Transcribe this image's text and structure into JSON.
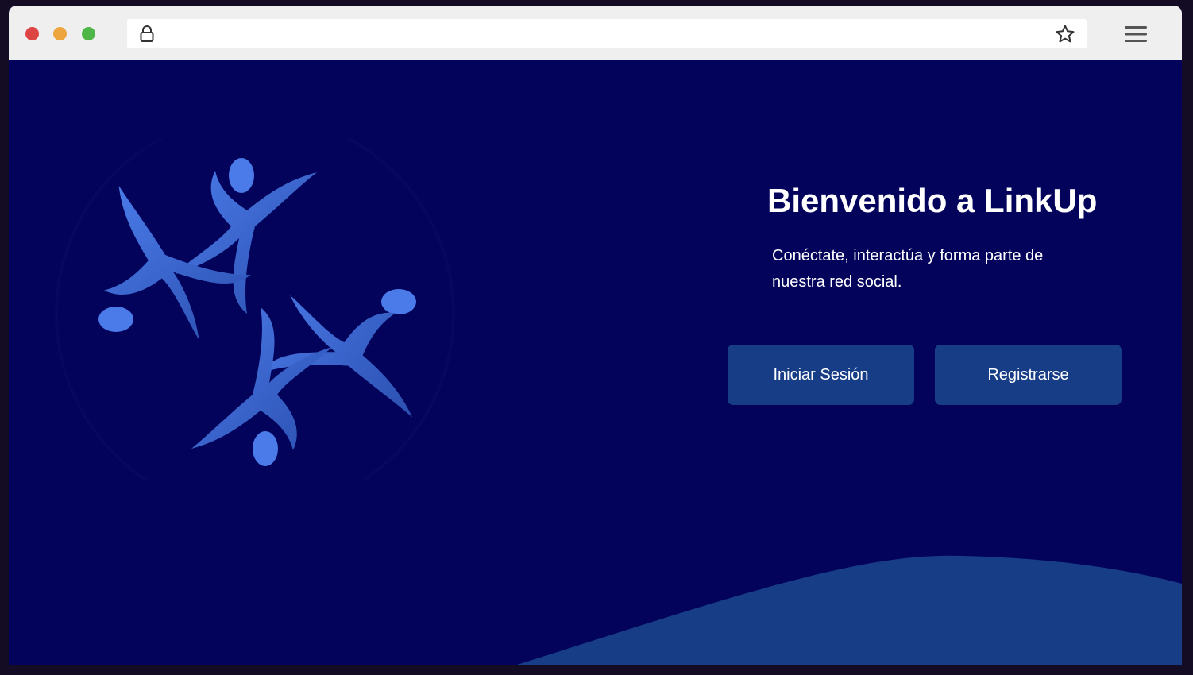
{
  "browser": {
    "traffic_lights": [
      {
        "name": "close",
        "color": "#dd4444"
      },
      {
        "name": "minimize",
        "color": "#eda53f"
      },
      {
        "name": "zoom",
        "color": "#4db647"
      }
    ],
    "url_icon": "lock-icon",
    "bookmark_icon": "star-icon",
    "menu_icon": "hamburger-menu-icon"
  },
  "hero": {
    "title": "Bienvenido a LinkUp",
    "subtitle": "Conéctate, interactúa y forma parte de nuestra red social.",
    "logo_icon": "people-circle-logo"
  },
  "actions": {
    "login_label": "Iniciar Sesión",
    "register_label": "Registrarse"
  },
  "colors": {
    "background": "#03035c",
    "accent": "#173d86",
    "logo": "#3f6ed6",
    "wave": "#173d86"
  }
}
